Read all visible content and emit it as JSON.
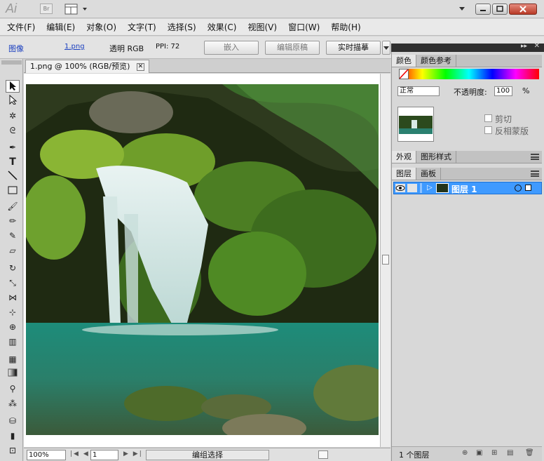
{
  "app": {
    "logo": "Ai",
    "bridge_label": "Br"
  },
  "menu": [
    "文件(F)",
    "编辑(E)",
    "对象(O)",
    "文字(T)",
    "选择(S)",
    "效果(C)",
    "视图(V)",
    "窗口(W)",
    "帮助(H)"
  ],
  "control_bar": {
    "object_type": "图像",
    "file_link": "1.png",
    "info": "透明 RGB",
    "ppi_label": "PPI: 72",
    "embed_label": "嵌入",
    "edit_original_label": "编辑原稿",
    "live_trace_label": "实时描摹"
  },
  "document": {
    "tab_title": "1.png @ 100% (RGB/预览)"
  },
  "status": {
    "zoom": "100%",
    "artboard": "1",
    "status_text": "编组选择"
  },
  "panels": {
    "color": {
      "tab": "颜色",
      "tab2": "颜色参考"
    },
    "transparency": {
      "blend_mode": "正常",
      "opacity_label": "不透明度:",
      "opacity_value": "100",
      "opacity_unit": "%",
      "clip_label": "剪切",
      "invert_mask_label": "反相蒙版"
    },
    "appearance": {
      "tab": "外观",
      "tab2": "图形样式"
    },
    "layers": {
      "tab": "图层",
      "tab2": "画板",
      "layer_name": "图层 1",
      "count": "1 个图层"
    }
  },
  "colors": {
    "accent": "#3399ff",
    "layer_highlight": "#3f9aff",
    "close": "#c0412d"
  }
}
